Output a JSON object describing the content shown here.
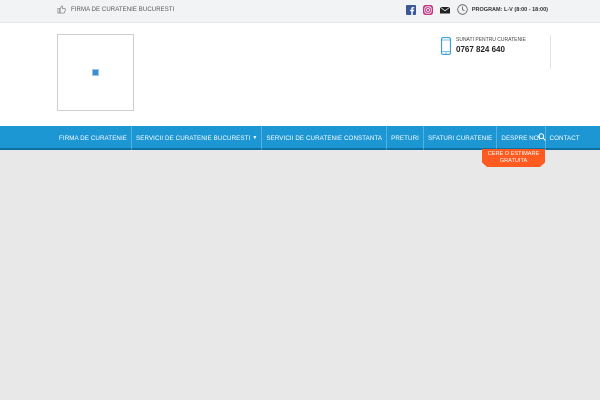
{
  "topbar": {
    "tagline": "FIRMA DE CURATENIE BUCURESTI",
    "schedule": "PROGRAM: L-V (8:00 - 18:00)",
    "social": [
      "facebook-icon",
      "instagram-icon",
      "envelope-icon"
    ]
  },
  "header": {
    "contact_label": "SUNATI PENTRU CURATENIE",
    "phone": "0767 824 640"
  },
  "nav": {
    "items": [
      {
        "label": "FIRMA DE CURATENIE"
      },
      {
        "label": "SERVICII DE CURATENIE BUCURESTI",
        "has_dropdown": true
      },
      {
        "label": "SERVICII DE CURATENIE CONSTANTA"
      },
      {
        "label": "PRETURI"
      },
      {
        "label": "SFATURI CURATENIE"
      },
      {
        "label": "DESPRE NOI"
      },
      {
        "label": "CONTACT"
      }
    ]
  },
  "cta": {
    "line1": "CERE O ESTIMARE",
    "line2": "GRATUITA"
  },
  "colors": {
    "nav_bg": "#1d97d4",
    "cta_bg": "#ff5a1f",
    "facebook": "#3b5998",
    "instagram": "#c13584"
  }
}
